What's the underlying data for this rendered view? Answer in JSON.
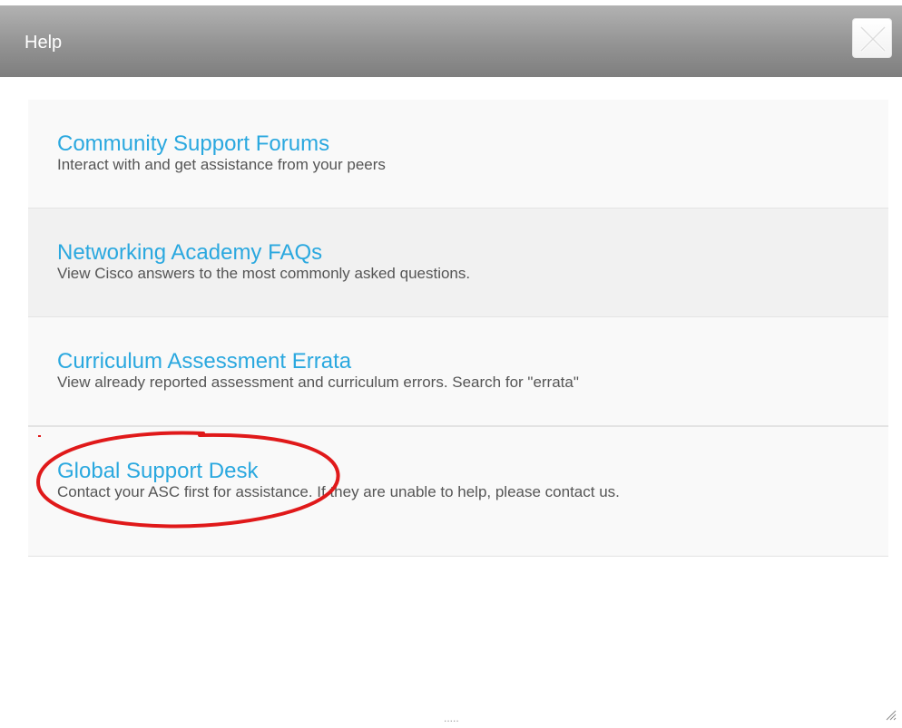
{
  "dialog": {
    "title": "Help",
    "close_icon": "close-icon"
  },
  "items": [
    {
      "title": "Community Support Forums",
      "description": "Interact with and get assistance from your peers"
    },
    {
      "title": "Networking Academy FAQs",
      "description": "View Cisco answers to the most commonly asked questions."
    },
    {
      "title": "Curriculum Assessment Errata",
      "description": "View already reported assessment and curriculum errors. Search for \"errata\""
    },
    {
      "title": "Global Support Desk",
      "description": "Contact your ASC first for assistance. If they are unable to help, please contact us."
    }
  ],
  "footer": {
    "pager": ".....",
    "resize_icon": "resize-grip-icon"
  },
  "colors": {
    "link": "#2aa8df",
    "annotation": "#e0191a",
    "title_bar": "#939393"
  }
}
